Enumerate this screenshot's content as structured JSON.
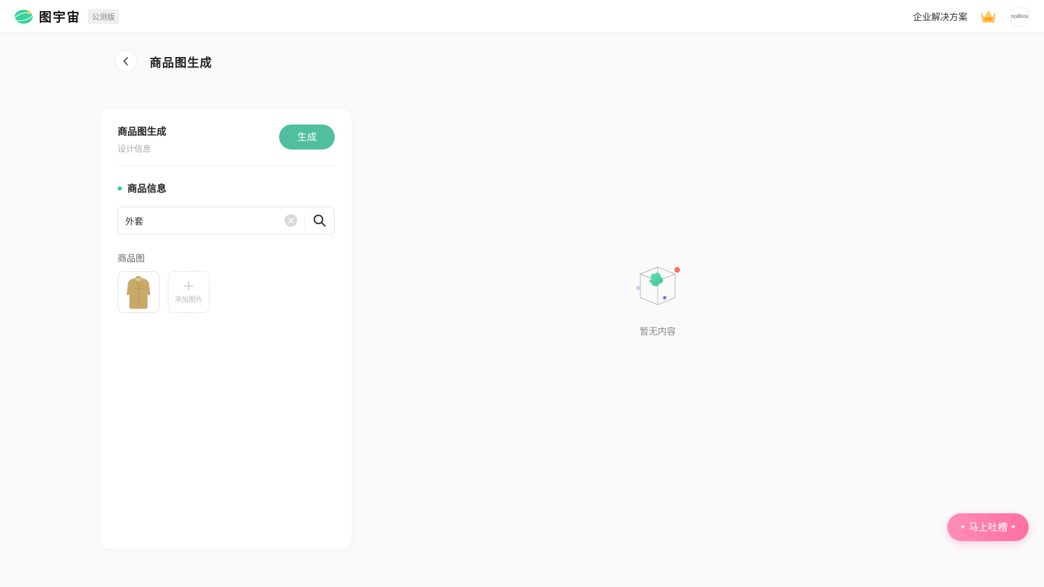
{
  "header": {
    "app_name": "图宇宙",
    "beta_label": "公测版",
    "enterprise_link": "企业解决方案",
    "avatar_text": "nolibox"
  },
  "page": {
    "title": "商品图生成"
  },
  "panel": {
    "title": "商品图生成",
    "subtitle": "设计信息",
    "generate_label": "生成",
    "section_label": "商品信息",
    "input_value": "外套",
    "image_label": "商品图",
    "add_image_label": "添加图片"
  },
  "empty": {
    "text": "暂无内容"
  },
  "feedback": {
    "label": "马上吐槽"
  }
}
